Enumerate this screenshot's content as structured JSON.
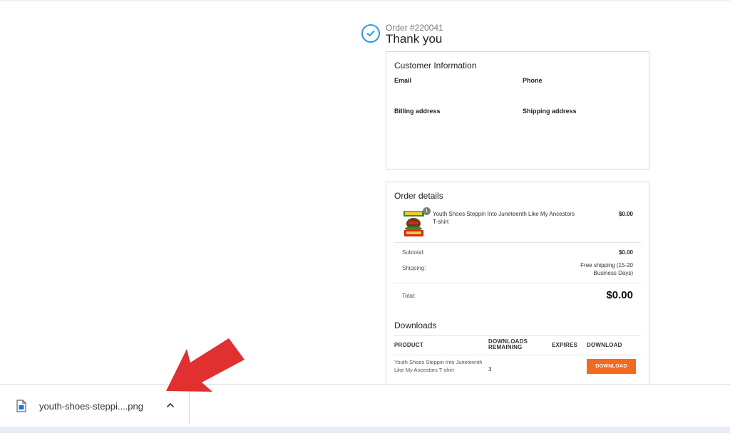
{
  "order": {
    "number": "Order #220041",
    "title": "Thank you"
  },
  "customer": {
    "title": "Customer Information",
    "email_label": "Email",
    "phone_label": "Phone",
    "billing_label": "Billing address",
    "shipping_label": "Shipping address"
  },
  "details": {
    "title": "Order details",
    "item": {
      "name": "Youth Shoes Steppin Into Juneteenth Like My Ancestors T-shirt",
      "quantity": "1",
      "price": "$0.00"
    },
    "subtotal_label": "Subtotal:",
    "subtotal_value": "$0.00",
    "shipping_label": "Shipping:",
    "shipping_value": "Free shipping (15-20 Business Days)",
    "total_label": "Total:",
    "total_value": "$0.00"
  },
  "downloads": {
    "title": "Downloads",
    "headers": {
      "product": "PRODUCT",
      "remaining": "DOWNLOADS REMAINING",
      "expires": "EXPIRES",
      "download": "DOWNLOAD"
    },
    "rows": [
      {
        "product": "Youth Shoes Steppin Into Juneteenth Like My Ancestors T-shirt",
        "remaining": "3",
        "expires": "",
        "button": "DOWNLOAD"
      }
    ]
  },
  "download_bar": {
    "file_name": "youth-shoes-steppi....png"
  },
  "colors": {
    "accent": "#2b9be6",
    "button": "#f26a21",
    "arrow": "#e03030"
  }
}
